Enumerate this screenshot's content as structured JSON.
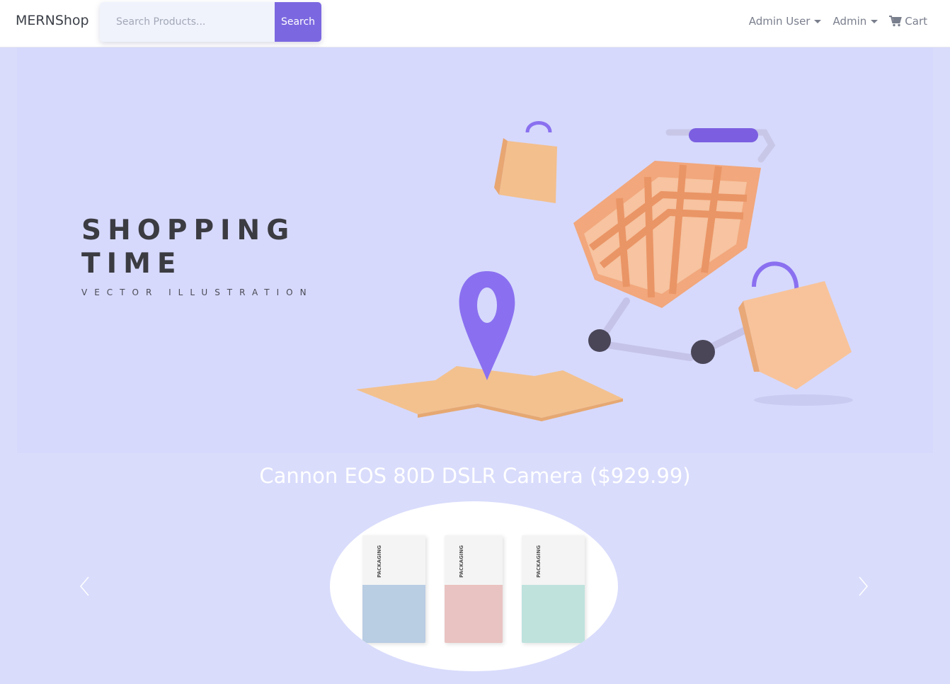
{
  "navbar": {
    "brand": "MERNShop",
    "search_placeholder": "Search Products...",
    "search_button": "Search",
    "links": {
      "user": "Admin User",
      "admin": "Admin",
      "cart": "Cart"
    }
  },
  "hero": {
    "title_line1": "SHOPPING",
    "title_line2": "TIME",
    "subtitle": "VECTOR ILLUSTRATION"
  },
  "carousel": {
    "caption": "Cannon EOS 80D DSLR Camera ($929.99)",
    "product_box_label": "PACKAGING"
  },
  "colors": {
    "accent": "#7b68e0",
    "hero_bg": "#d6d9fc",
    "page_bg": "#d9dcfb"
  },
  "icons": [
    "cart-icon",
    "chevron-left-icon",
    "chevron-right-icon",
    "caret-down-icon"
  ]
}
